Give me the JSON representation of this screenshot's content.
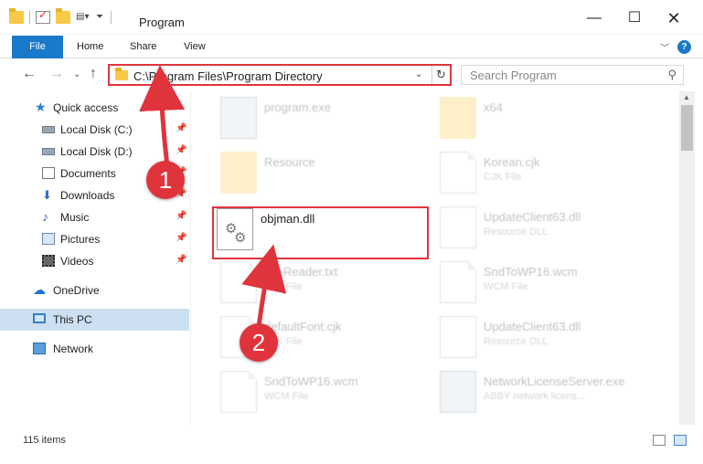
{
  "window": {
    "title": "Program",
    "controls": {
      "minimize": "—",
      "maximize": "☐",
      "close": "✕"
    }
  },
  "ribbon": {
    "tabs": [
      "File",
      "Home",
      "Share",
      "View"
    ],
    "expand_icon": "chevron-down-icon",
    "help_icon": "?"
  },
  "navigation": {
    "address": "C:\\Program Files\\Program Directory",
    "search_placeholder": "Search Program"
  },
  "sidebar": {
    "items": [
      {
        "label": "Quick access",
        "icon": "star-icon",
        "pinned": false
      },
      {
        "label": "Local Disk (C:)",
        "icon": "drive-icon",
        "pinned": true
      },
      {
        "label": "Local Disk (D:)",
        "icon": "drive-icon",
        "pinned": true
      },
      {
        "label": "Documents",
        "icon": "documents-icon",
        "pinned": true
      },
      {
        "label": "Downloads",
        "icon": "downloads-icon",
        "pinned": true
      },
      {
        "label": "Music",
        "icon": "music-icon",
        "pinned": true
      },
      {
        "label": "Pictures",
        "icon": "pictures-icon",
        "pinned": true
      },
      {
        "label": "Videos",
        "icon": "videos-icon",
        "pinned": true
      },
      {
        "label": "OneDrive",
        "icon": "onedrive-icon",
        "pinned": false
      },
      {
        "label": "This PC",
        "icon": "this-pc-icon",
        "pinned": false,
        "selected": true
      },
      {
        "label": "Network",
        "icon": "network-icon",
        "pinned": false
      }
    ]
  },
  "files": [
    {
      "name": "program.exe",
      "type": "",
      "kind": "exe"
    },
    {
      "name": "x64",
      "type": "",
      "kind": "folder"
    },
    {
      "name": "Resource",
      "type": "",
      "kind": "folder"
    },
    {
      "name": "Korean.cjk",
      "type": "CJK File",
      "kind": "doc"
    },
    {
      "name": "objman.dll",
      "type": "",
      "kind": "dll",
      "highlighted": true
    },
    {
      "name": "UpdateClient63.dll",
      "type": "Resource DLL",
      "kind": "dll"
    },
    {
      "name": "fineReader.txt",
      "type": "TXT File",
      "kind": "doc"
    },
    {
      "name": "SndToWP16.wcm",
      "type": "WCM File",
      "kind": "doc"
    },
    {
      "name": "defaultFont.cjk",
      "type": "CJK File",
      "kind": "doc"
    },
    {
      "name": "UpdateClient63.dll",
      "type": "Resource DLL",
      "kind": "dll"
    },
    {
      "name": "SndToWP16.wcm",
      "type": "WCM File",
      "kind": "doc"
    },
    {
      "name": "NetworkLicenseServer.exe",
      "type": "ABBY network licens...",
      "kind": "exe"
    }
  ],
  "status": {
    "item_count": "115 items"
  },
  "annotations": {
    "step1": "1",
    "step2": "2",
    "color": "#e0343d"
  }
}
